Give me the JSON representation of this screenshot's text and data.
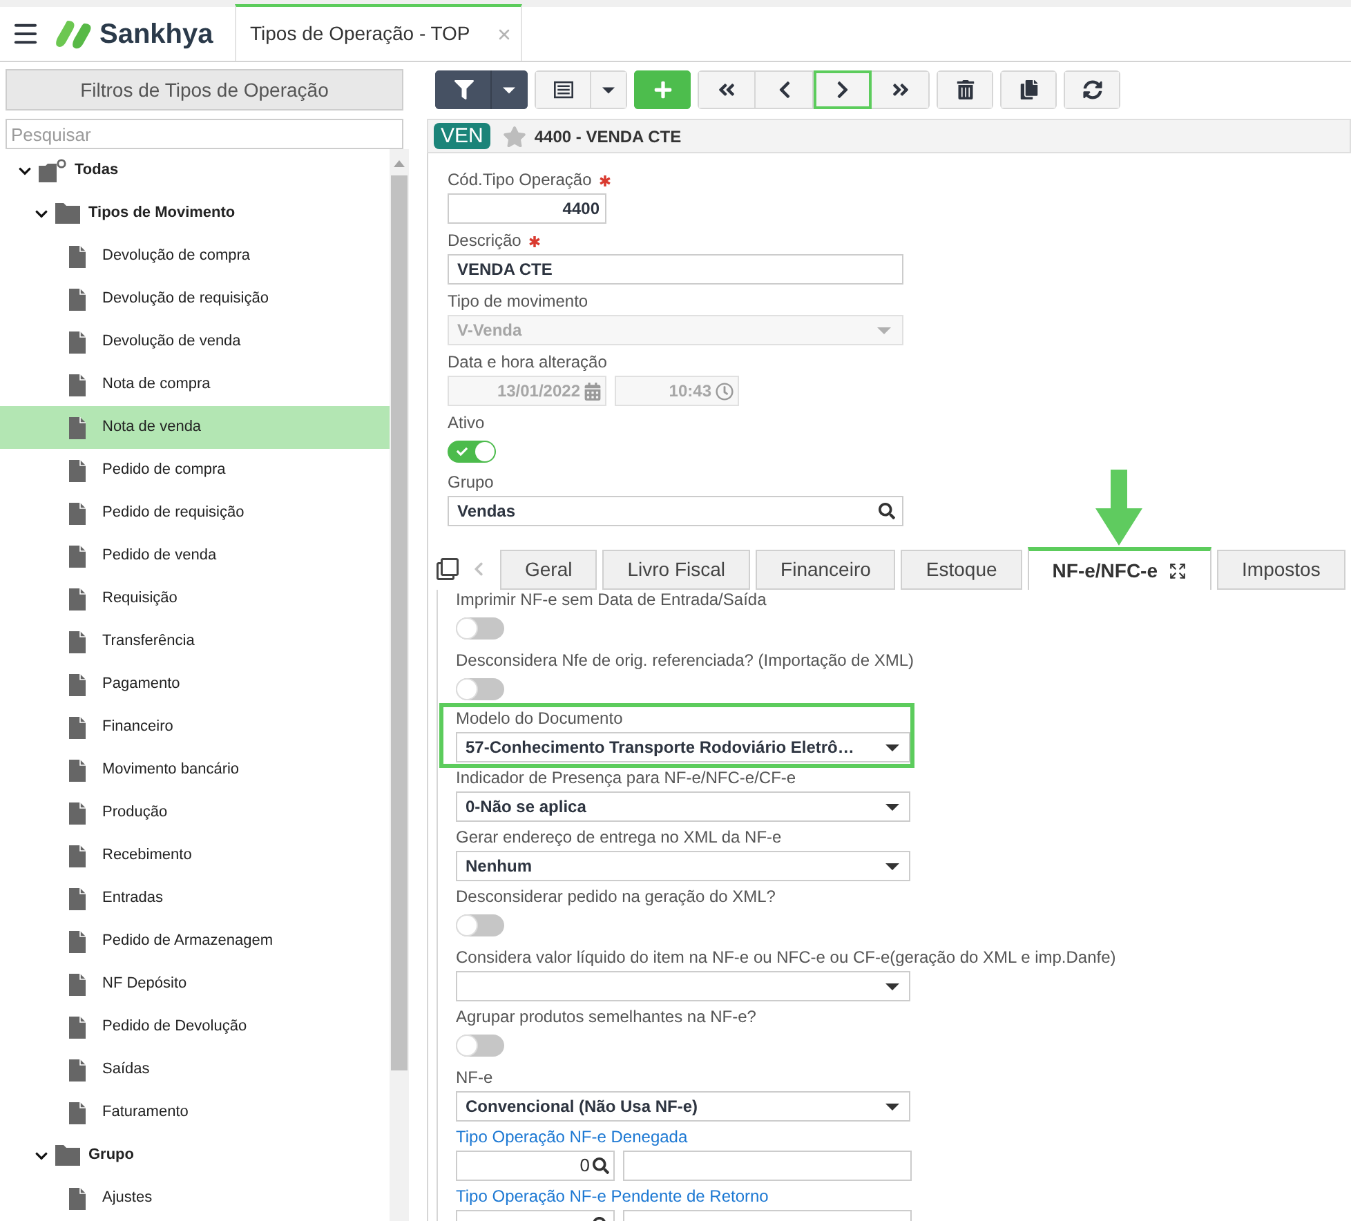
{
  "header": {
    "brand": "Sankhya",
    "tabs": [
      {
        "label": "Tipos de Operação - TOP",
        "selected": true
      }
    ]
  },
  "sidebar": {
    "filter_button": "Filtros de Tipos de Operação",
    "search": {
      "placeholder": "Pesquisar"
    },
    "tree": [
      {
        "label": "Todas",
        "kind": "root",
        "expanded": true,
        "selected": false,
        "children": [
          {
            "label": "Tipos de Movimento",
            "kind": "folder",
            "expanded": true,
            "selected": false,
            "children": [
              {
                "label": "Devolução de compra",
                "kind": "document",
                "selected": false
              },
              {
                "label": "Devolução de requisição",
                "kind": "document",
                "selected": false
              },
              {
                "label": "Devolução de venda",
                "kind": "document",
                "selected": false
              },
              {
                "label": "Nota de compra",
                "kind": "document",
                "selected": false
              },
              {
                "label": "Nota de venda",
                "kind": "document",
                "selected": true
              },
              {
                "label": "Pedido de compra",
                "kind": "document",
                "selected": false
              },
              {
                "label": "Pedido de requisição",
                "kind": "document",
                "selected": false
              },
              {
                "label": "Pedido de venda",
                "kind": "document",
                "selected": false
              },
              {
                "label": "Requisição",
                "kind": "document",
                "selected": false
              },
              {
                "label": "Transferência",
                "kind": "document",
                "selected": false
              },
              {
                "label": "Pagamento",
                "kind": "document",
                "selected": false
              },
              {
                "label": "Financeiro",
                "kind": "document",
                "selected": false
              },
              {
                "label": "Movimento bancário",
                "kind": "document",
                "selected": false
              },
              {
                "label": "Produção",
                "kind": "document",
                "selected": false
              },
              {
                "label": "Recebimento",
                "kind": "document",
                "selected": false
              },
              {
                "label": "Entradas",
                "kind": "document",
                "selected": false
              },
              {
                "label": "Pedido de Armazenagem",
                "kind": "document",
                "selected": false
              },
              {
                "label": "NF Depósito",
                "kind": "document",
                "selected": false
              },
              {
                "label": "Pedido de Devolução",
                "kind": "document",
                "selected": false
              },
              {
                "label": "Saídas",
                "kind": "document",
                "selected": false
              },
              {
                "label": "Faturamento",
                "kind": "document",
                "selected": false
              }
            ]
          },
          {
            "label": "Grupo",
            "kind": "folder",
            "expanded": true,
            "selected": false,
            "children": [
              {
                "label": "Ajustes",
                "kind": "document",
                "selected": false
              }
            ]
          }
        ]
      }
    ]
  },
  "toolbar": {
    "groups": [
      {
        "buttons": [
          {
            "kind": "filter",
            "menu": true,
            "highlighted": false
          }
        ]
      },
      {
        "buttons": [
          {
            "kind": "grid",
            "menu": true,
            "highlighted": false
          }
        ]
      },
      {
        "buttons": [
          {
            "kind": "add",
            "menu": false,
            "highlighted": false
          }
        ]
      },
      {
        "buttons": [
          {
            "kind": "first",
            "menu": false,
            "highlighted": false
          },
          {
            "kind": "previous",
            "menu": false,
            "highlighted": false
          },
          {
            "kind": "next",
            "menu": false,
            "highlighted": true
          },
          {
            "kind": "last",
            "menu": false,
            "highlighted": false
          }
        ]
      },
      {
        "buttons": [
          {
            "kind": "delete",
            "menu": false,
            "highlighted": false
          }
        ]
      },
      {
        "buttons": [
          {
            "kind": "duplicate",
            "menu": false,
            "highlighted": false
          }
        ]
      },
      {
        "buttons": [
          {
            "kind": "refresh",
            "menu": false,
            "highlighted": false
          }
        ]
      }
    ]
  },
  "record": {
    "badge": "VEN",
    "favorite": false,
    "title": "4400 - VENDA CTE"
  },
  "form": {
    "fields": [
      {
        "kind": "number",
        "label": "Cód.Tipo Operação",
        "required": true,
        "disabled": false,
        "value": "4400"
      },
      {
        "kind": "text",
        "label": "Descrição",
        "required": true,
        "disabled": false,
        "value": "VENDA CTE"
      },
      {
        "kind": "select",
        "label": "Tipo de movimento",
        "required": false,
        "disabled": true,
        "value": "V-Venda"
      },
      {
        "kind": "datetime",
        "label": "Data e hora alteração",
        "required": false,
        "disabled": true,
        "date": "13/01/2022",
        "time": "10:43"
      },
      {
        "kind": "toggle",
        "label": "Ativo",
        "required": false,
        "disabled": false,
        "on": true
      },
      {
        "kind": "lookup",
        "label": "Grupo",
        "required": false,
        "disabled": false,
        "value": "Vendas"
      }
    ]
  },
  "detail": {
    "tabs": [
      {
        "label": "Geral",
        "selected": false,
        "highlighted": false
      },
      {
        "label": "Livro Fiscal",
        "selected": false,
        "highlighted": false
      },
      {
        "label": "Financeiro",
        "selected": false,
        "highlighted": false
      },
      {
        "label": "Estoque",
        "selected": false,
        "highlighted": false
      },
      {
        "label": "NF-e/NFC-e",
        "selected": true,
        "highlighted": true
      },
      {
        "label": "Impostos",
        "selected": false,
        "highlighted": false
      }
    ],
    "fields": [
      {
        "kind": "toggle",
        "label": "Imprimir NF-e sem Data de Entrada/Saída",
        "on": false,
        "highlighted": false
      },
      {
        "kind": "toggle",
        "label": "Desconsidera Nfe de orig. referenciada? (Importação de XML)",
        "on": false,
        "highlighted": false
      },
      {
        "kind": "select",
        "label": "Modelo do Documento",
        "value": "57-Conhecimento Transporte Rodoviário Eletrô…",
        "highlighted": true
      },
      {
        "kind": "select",
        "label": "Indicador de Presença para NF-e/NFC-e/CF-e",
        "value": "0-Não se aplica",
        "highlighted": false
      },
      {
        "kind": "select",
        "label": "Gerar endereço de entrega no XML da NF-e",
        "value": "Nenhum",
        "highlighted": false
      },
      {
        "kind": "toggle",
        "label": "Desconsiderar pedido na geração do XML?",
        "on": false,
        "highlighted": false
      },
      {
        "kind": "select",
        "label": "Considera valor líquido do item na NF-e ou NFC-e ou CF-e(geração do XML e imp.Danfe)",
        "highlighted": false
      },
      {
        "kind": "toggle",
        "label": "Agrupar produtos semelhantes na NF-e?",
        "on": false,
        "highlighted": false
      },
      {
        "kind": "select",
        "label": "NF-e",
        "value": "Convencional (Não Usa NF-e)",
        "highlighted": false
      },
      {
        "kind": "lookup_pair",
        "label": "Tipo Operação NF-e Denegada",
        "value": "0",
        "highlighted": false
      },
      {
        "kind": "lookup_pair",
        "label": "Tipo Operação NF-e Pendente de Retorno",
        "highlighted": false
      }
    ]
  }
}
